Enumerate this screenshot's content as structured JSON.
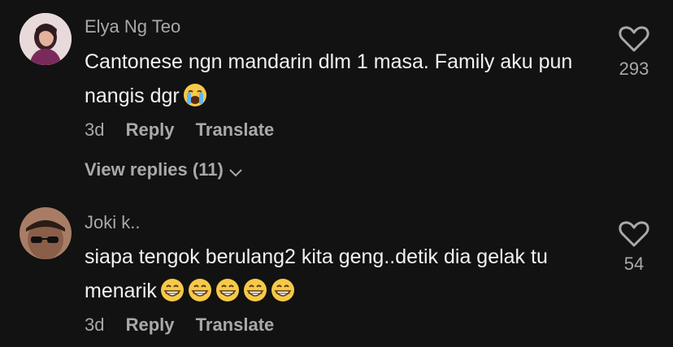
{
  "comments": [
    {
      "username": "Elya Ng Teo",
      "text": "Cantonese ngn mandarin dlm 1 masa. Family aku pun nangis dgr",
      "emoji": "crying-face",
      "time": "3d",
      "reply_label": "Reply",
      "translate_label": "Translate",
      "likes": "293",
      "view_replies": "View replies (11)"
    },
    {
      "username": "Joki k..",
      "text": "siapa tengok berulang2 kita geng..detik dia gelak tu menarik",
      "emoji": "grinning-face",
      "emoji_count": 5,
      "time": "3d",
      "reply_label": "Reply",
      "translate_label": "Translate",
      "likes": "54"
    }
  ],
  "colors": {
    "background": "#121212",
    "primary_text": "#f1f1f2",
    "secondary_text": "#a9a9ab",
    "emoji_yellow": "#f7c948"
  }
}
